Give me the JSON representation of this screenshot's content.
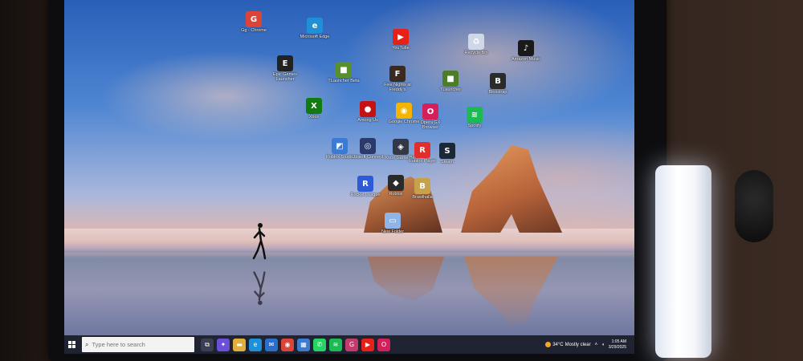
{
  "desktop": {
    "icons": [
      {
        "label": "Gg - Chrome",
        "icon": "chrome-profile-icon",
        "color": "#db4437",
        "glyph": "G"
      },
      {
        "label": "Microsoft Edge",
        "icon": "edge-icon",
        "color": "#1f8fd6",
        "glyph": "e"
      },
      {
        "label": "YouTube",
        "icon": "youtube-icon",
        "color": "#e62117",
        "glyph": "▶"
      },
      {
        "label": "Recycle Bin",
        "icon": "recycle-bin-icon",
        "color": "#cfd8e6",
        "glyph": "♻"
      },
      {
        "label": "Amazon Music",
        "icon": "amazon-music-icon",
        "color": "#1a1a1a",
        "glyph": "♪"
      },
      {
        "label": "Epic Games Launcher",
        "icon": "epic-games-icon",
        "color": "#222222",
        "glyph": "E"
      },
      {
        "label": "TLauncher Beta",
        "icon": "minecraft-icon",
        "color": "#5a8f2e",
        "glyph": "■"
      },
      {
        "label": "Five Nights at Freddy's",
        "icon": "fnaf-icon",
        "color": "#3a2a22",
        "glyph": "F"
      },
      {
        "label": "TLauncher",
        "icon": "minecraft-icon",
        "color": "#4e7d29",
        "glyph": "■"
      },
      {
        "label": "Bloxstrap",
        "icon": "bloxstrap-icon",
        "color": "#2b2b2b",
        "glyph": "B"
      },
      {
        "label": "Xbox",
        "icon": "xbox-icon",
        "color": "#107c10",
        "glyph": "X"
      },
      {
        "label": "Among Us",
        "icon": "among-us-icon",
        "color": "#c51111",
        "glyph": "●"
      },
      {
        "label": "Google Chrome",
        "icon": "chrome-icon",
        "color": "#f4b400",
        "glyph": "◉"
      },
      {
        "label": "Opera GX Browser",
        "icon": "opera-gx-icon",
        "color": "#d4205a",
        "glyph": "O"
      },
      {
        "label": "Spotify",
        "icon": "spotify-icon",
        "color": "#1db954",
        "glyph": "≋"
      },
      {
        "label": "Roblox Studio",
        "icon": "roblox-studio-icon",
        "color": "#3b7bd6",
        "glyph": "◩"
      },
      {
        "label": "Ubisoft Connect",
        "icon": "ubisoft-icon",
        "color": "#2a3a6a",
        "glyph": "◎"
      },
      {
        "label": "Xbox Game Bar",
        "icon": "game-icon",
        "color": "#333844",
        "glyph": "◈"
      },
      {
        "label": "Roblox Player",
        "icon": "roblox-icon",
        "color": "#e22d2d",
        "glyph": "R"
      },
      {
        "label": "Steam",
        "icon": "steam-icon",
        "color": "#1b2838",
        "glyph": "S"
      },
      {
        "label": "Rocket League",
        "icon": "rocket-league-icon",
        "color": "#2d5bd8",
        "glyph": "R"
      },
      {
        "label": "Roblox",
        "icon": "roblox-icon",
        "color": "#2a2a2a",
        "glyph": "◆"
      },
      {
        "label": "Brawlhalla",
        "icon": "brawlhalla-icon",
        "color": "#c8a24a",
        "glyph": "B"
      },
      {
        "label": "New Folder",
        "icon": "folder-icon",
        "color": "#8fb4e8",
        "glyph": "▭"
      }
    ]
  },
  "taskbar": {
    "search_placeholder": "Type here to search",
    "apps": [
      {
        "name": "task-view-icon",
        "glyph": "⧉",
        "color": "#3a3f52"
      },
      {
        "name": "copilot-icon",
        "glyph": "✦",
        "color": "#6b4fd8"
      },
      {
        "name": "file-explorer-icon",
        "glyph": "▬",
        "color": "#e0b03a"
      },
      {
        "name": "edge-icon",
        "glyph": "e",
        "color": "#1f8fd6"
      },
      {
        "name": "mail-icon",
        "glyph": "✉",
        "color": "#2b6fcb"
      },
      {
        "name": "chrome-icon",
        "glyph": "◉",
        "color": "#db4437"
      },
      {
        "name": "store-icon",
        "glyph": "▦",
        "color": "#3d7bd1"
      },
      {
        "name": "whatsapp-icon",
        "glyph": "✆",
        "color": "#25d366"
      },
      {
        "name": "spotify-icon",
        "glyph": "≋",
        "color": "#1db954"
      },
      {
        "name": "chrome-profile-icon",
        "glyph": "G",
        "color": "#c23b6b"
      },
      {
        "name": "youtube-icon",
        "glyph": "▶",
        "color": "#e62117"
      },
      {
        "name": "opera-gx-icon",
        "glyph": "O",
        "color": "#d4205a"
      }
    ],
    "weather": {
      "temp": "34°C",
      "condition": "Mostly clear"
    },
    "clock": {
      "time": "1:05 AM",
      "date": "3/29/2025"
    }
  }
}
